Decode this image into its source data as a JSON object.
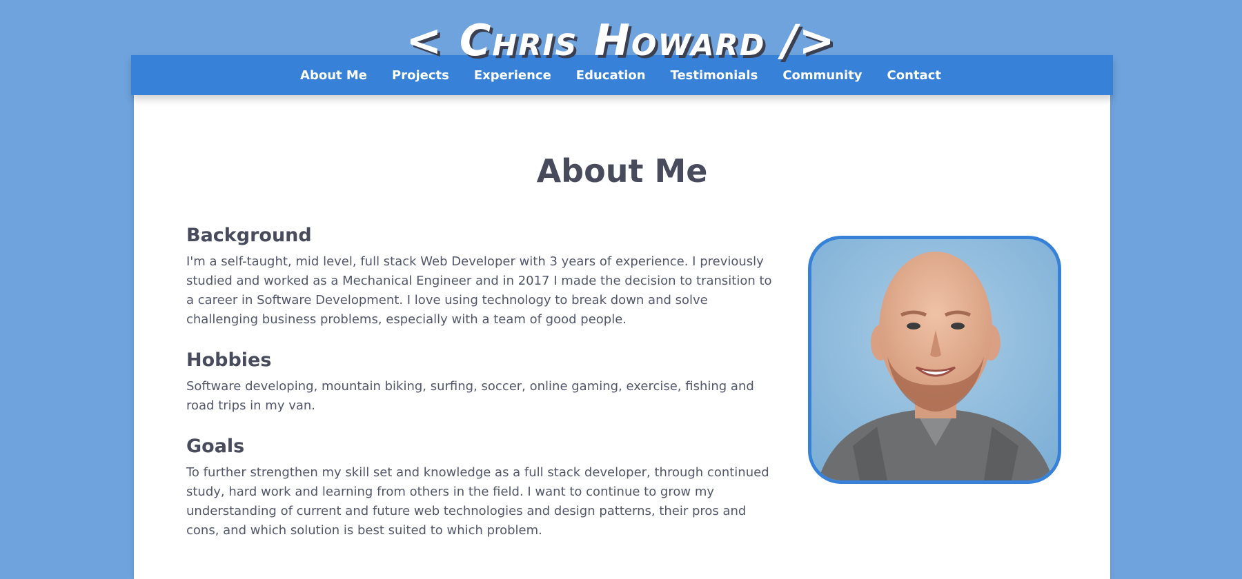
{
  "site": {
    "title": "< Chris Howard />"
  },
  "nav": {
    "items": [
      {
        "label": "About Me"
      },
      {
        "label": "Projects"
      },
      {
        "label": "Experience"
      },
      {
        "label": "Education"
      },
      {
        "label": "Testimonials"
      },
      {
        "label": "Community"
      },
      {
        "label": "Contact"
      }
    ]
  },
  "about": {
    "title": "About Me",
    "sections": [
      {
        "heading": "Background",
        "body": "I'm a self-taught, mid level, full stack Web Developer with 3 years of experience. I previously studied and worked as a Mechanical Engineer and in 2017 I made the decision to transition to a career in Software Development. I love using technology to break down and solve challenging business problems, especially with a team of good people."
      },
      {
        "heading": "Hobbies",
        "body": "Software developing, mountain biking, surfing, soccer, online gaming, exercise, fishing and road trips in my van."
      },
      {
        "heading": "Goals",
        "body": "To further strengthen my skill set and knowledge as a full stack developer, through continued study, hard work and learning from others in the field. I want to continue to grow my understanding of current and future web technologies and design patterns, their pros and cons, and which solution is best suited to which problem."
      }
    ]
  },
  "colors": {
    "background": "#6fa3dd",
    "nav": "#3782d8",
    "heading": "#474b5c",
    "body_text": "#51566a"
  }
}
